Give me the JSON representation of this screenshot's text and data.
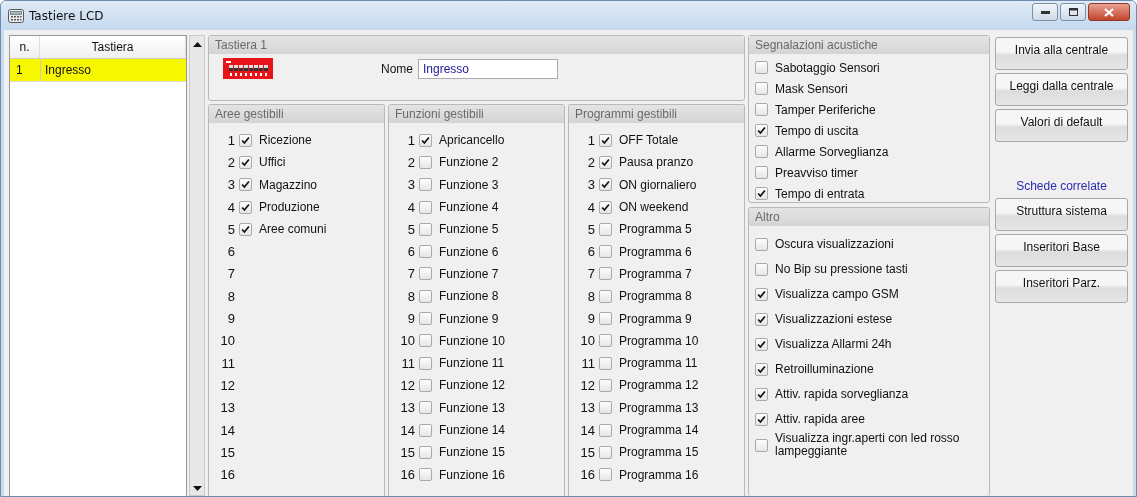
{
  "window": {
    "title": "Tastiere LCD"
  },
  "keypad_list": {
    "columns": [
      "n.",
      "Tastiera"
    ],
    "rows": [
      {
        "number": "1",
        "name": "Ingresso",
        "selected": true
      }
    ]
  },
  "keypad_group": {
    "title": "Tastiera 1",
    "name_label": "Nome",
    "name_value": "Ingresso"
  },
  "lists": [
    {
      "title": "Aree gestibili",
      "items": [
        {
          "kind": "checkbox",
          "number": "1",
          "label": "Ricezione",
          "checked": true
        },
        {
          "kind": "checkbox",
          "number": "2",
          "label": "Uffici",
          "checked": true
        },
        {
          "kind": "checkbox",
          "number": "3",
          "label": "Magazzino",
          "checked": true
        },
        {
          "kind": "checkbox",
          "number": "4",
          "label": "Produzione",
          "checked": true
        },
        {
          "kind": "checkbox",
          "number": "5",
          "label": "Aree comuni",
          "checked": true
        },
        {
          "kind": "empty",
          "number": "6"
        },
        {
          "kind": "empty",
          "number": "7"
        },
        {
          "kind": "empty",
          "number": "8"
        },
        {
          "kind": "empty",
          "number": "9"
        },
        {
          "kind": "empty",
          "number": "10"
        },
        {
          "kind": "empty",
          "number": "11"
        },
        {
          "kind": "empty",
          "number": "12"
        },
        {
          "kind": "empty",
          "number": "13"
        },
        {
          "kind": "empty",
          "number": "14"
        },
        {
          "kind": "empty",
          "number": "15"
        },
        {
          "kind": "empty",
          "number": "16"
        }
      ]
    },
    {
      "title": "Funzioni gestibili",
      "items": [
        {
          "kind": "checkbox",
          "number": "1",
          "label": "Apricancello",
          "checked": true
        },
        {
          "kind": "checkbox",
          "number": "2",
          "label": "Funzione 2",
          "checked": false
        },
        {
          "kind": "checkbox",
          "number": "3",
          "label": "Funzione 3",
          "checked": false
        },
        {
          "kind": "checkbox",
          "number": "4",
          "label": "Funzione 4",
          "checked": false
        },
        {
          "kind": "checkbox",
          "number": "5",
          "label": "Funzione 5",
          "checked": false
        },
        {
          "kind": "checkbox",
          "number": "6",
          "label": "Funzione 6",
          "checked": false
        },
        {
          "kind": "checkbox",
          "number": "7",
          "label": "Funzione 7",
          "checked": false
        },
        {
          "kind": "checkbox",
          "number": "8",
          "label": "Funzione 8",
          "checked": false
        },
        {
          "kind": "checkbox",
          "number": "9",
          "label": "Funzione 9",
          "checked": false
        },
        {
          "kind": "checkbox",
          "number": "10",
          "label": "Funzione 10",
          "checked": false
        },
        {
          "kind": "checkbox",
          "number": "11",
          "label": "Funzione 11",
          "checked": false
        },
        {
          "kind": "checkbox",
          "number": "12",
          "label": "Funzione 12",
          "checked": false
        },
        {
          "kind": "checkbox",
          "number": "13",
          "label": "Funzione 13",
          "checked": false
        },
        {
          "kind": "checkbox",
          "number": "14",
          "label": "Funzione 14",
          "checked": false
        },
        {
          "kind": "checkbox",
          "number": "15",
          "label": "Funzione 15",
          "checked": false
        },
        {
          "kind": "checkbox",
          "number": "16",
          "label": "Funzione 16",
          "checked": false
        }
      ]
    },
    {
      "title": "Programmi gestibili",
      "items": [
        {
          "kind": "checkbox",
          "number": "1",
          "label": "OFF Totale",
          "checked": true
        },
        {
          "kind": "checkbox",
          "number": "2",
          "label": "Pausa pranzo",
          "checked": true
        },
        {
          "kind": "checkbox",
          "number": "3",
          "label": "ON giornaliero",
          "checked": true
        },
        {
          "kind": "checkbox",
          "number": "4",
          "label": "ON weekend",
          "checked": true
        },
        {
          "kind": "checkbox",
          "number": "5",
          "label": "Programma 5",
          "checked": false
        },
        {
          "kind": "checkbox",
          "number": "6",
          "label": "Programma 6",
          "checked": false
        },
        {
          "kind": "checkbox",
          "number": "7",
          "label": "Programma 7",
          "checked": false
        },
        {
          "kind": "checkbox",
          "number": "8",
          "label": "Programma 8",
          "checked": false
        },
        {
          "kind": "checkbox",
          "number": "9",
          "label": "Programma 9",
          "checked": false
        },
        {
          "kind": "checkbox",
          "number": "10",
          "label": "Programma 10",
          "checked": false
        },
        {
          "kind": "checkbox",
          "number": "11",
          "label": "Programma 11",
          "checked": false
        },
        {
          "kind": "checkbox",
          "number": "12",
          "label": "Programma 12",
          "checked": false
        },
        {
          "kind": "checkbox",
          "number": "13",
          "label": "Programma 13",
          "checked": false
        },
        {
          "kind": "checkbox",
          "number": "14",
          "label": "Programma 14",
          "checked": false
        },
        {
          "kind": "checkbox",
          "number": "15",
          "label": "Programma 15",
          "checked": false
        },
        {
          "kind": "checkbox",
          "number": "16",
          "label": "Programma 16",
          "checked": false
        }
      ]
    }
  ],
  "acoustic_signals": {
    "title": "Segnalazioni acustiche",
    "items": [
      {
        "label": "Sabotaggio Sensori",
        "checked": false
      },
      {
        "label": "Mask Sensori",
        "checked": false
      },
      {
        "label": "Tamper Periferiche",
        "checked": false
      },
      {
        "label": "Tempo di uscita",
        "checked": true
      },
      {
        "label": "Allarme Sorveglianza",
        "checked": false
      },
      {
        "label": "Preavviso timer",
        "checked": false
      },
      {
        "label": "Tempo di entrata",
        "checked": true
      }
    ]
  },
  "other": {
    "title": "Altro",
    "items": [
      {
        "label": "Oscura visualizzazioni",
        "checked": false
      },
      {
        "label": "No Bip su pressione tasti",
        "checked": false
      },
      {
        "label": "Visualizza campo GSM",
        "checked": true
      },
      {
        "label": "Visualizzazioni estese",
        "checked": true
      },
      {
        "label": "Visualizza Allarmi 24h",
        "checked": true
      },
      {
        "label": "Retroilluminazione",
        "checked": true
      },
      {
        "label": "Attiv. rapida sorveglianza",
        "checked": true
      },
      {
        "label": "Attiv. rapida aree",
        "checked": true
      },
      {
        "label": "Visualizza ingr.aperti con led rosso lampeggiante",
        "checked": false
      }
    ]
  },
  "actions": [
    "Invia alla centrale",
    "Leggi dalla centrale",
    "Valori di default"
  ],
  "related": {
    "title": "Schede correlate",
    "buttons": [
      "Struttura sistema",
      "Inseritori Base",
      "Inseritori Parz."
    ]
  }
}
